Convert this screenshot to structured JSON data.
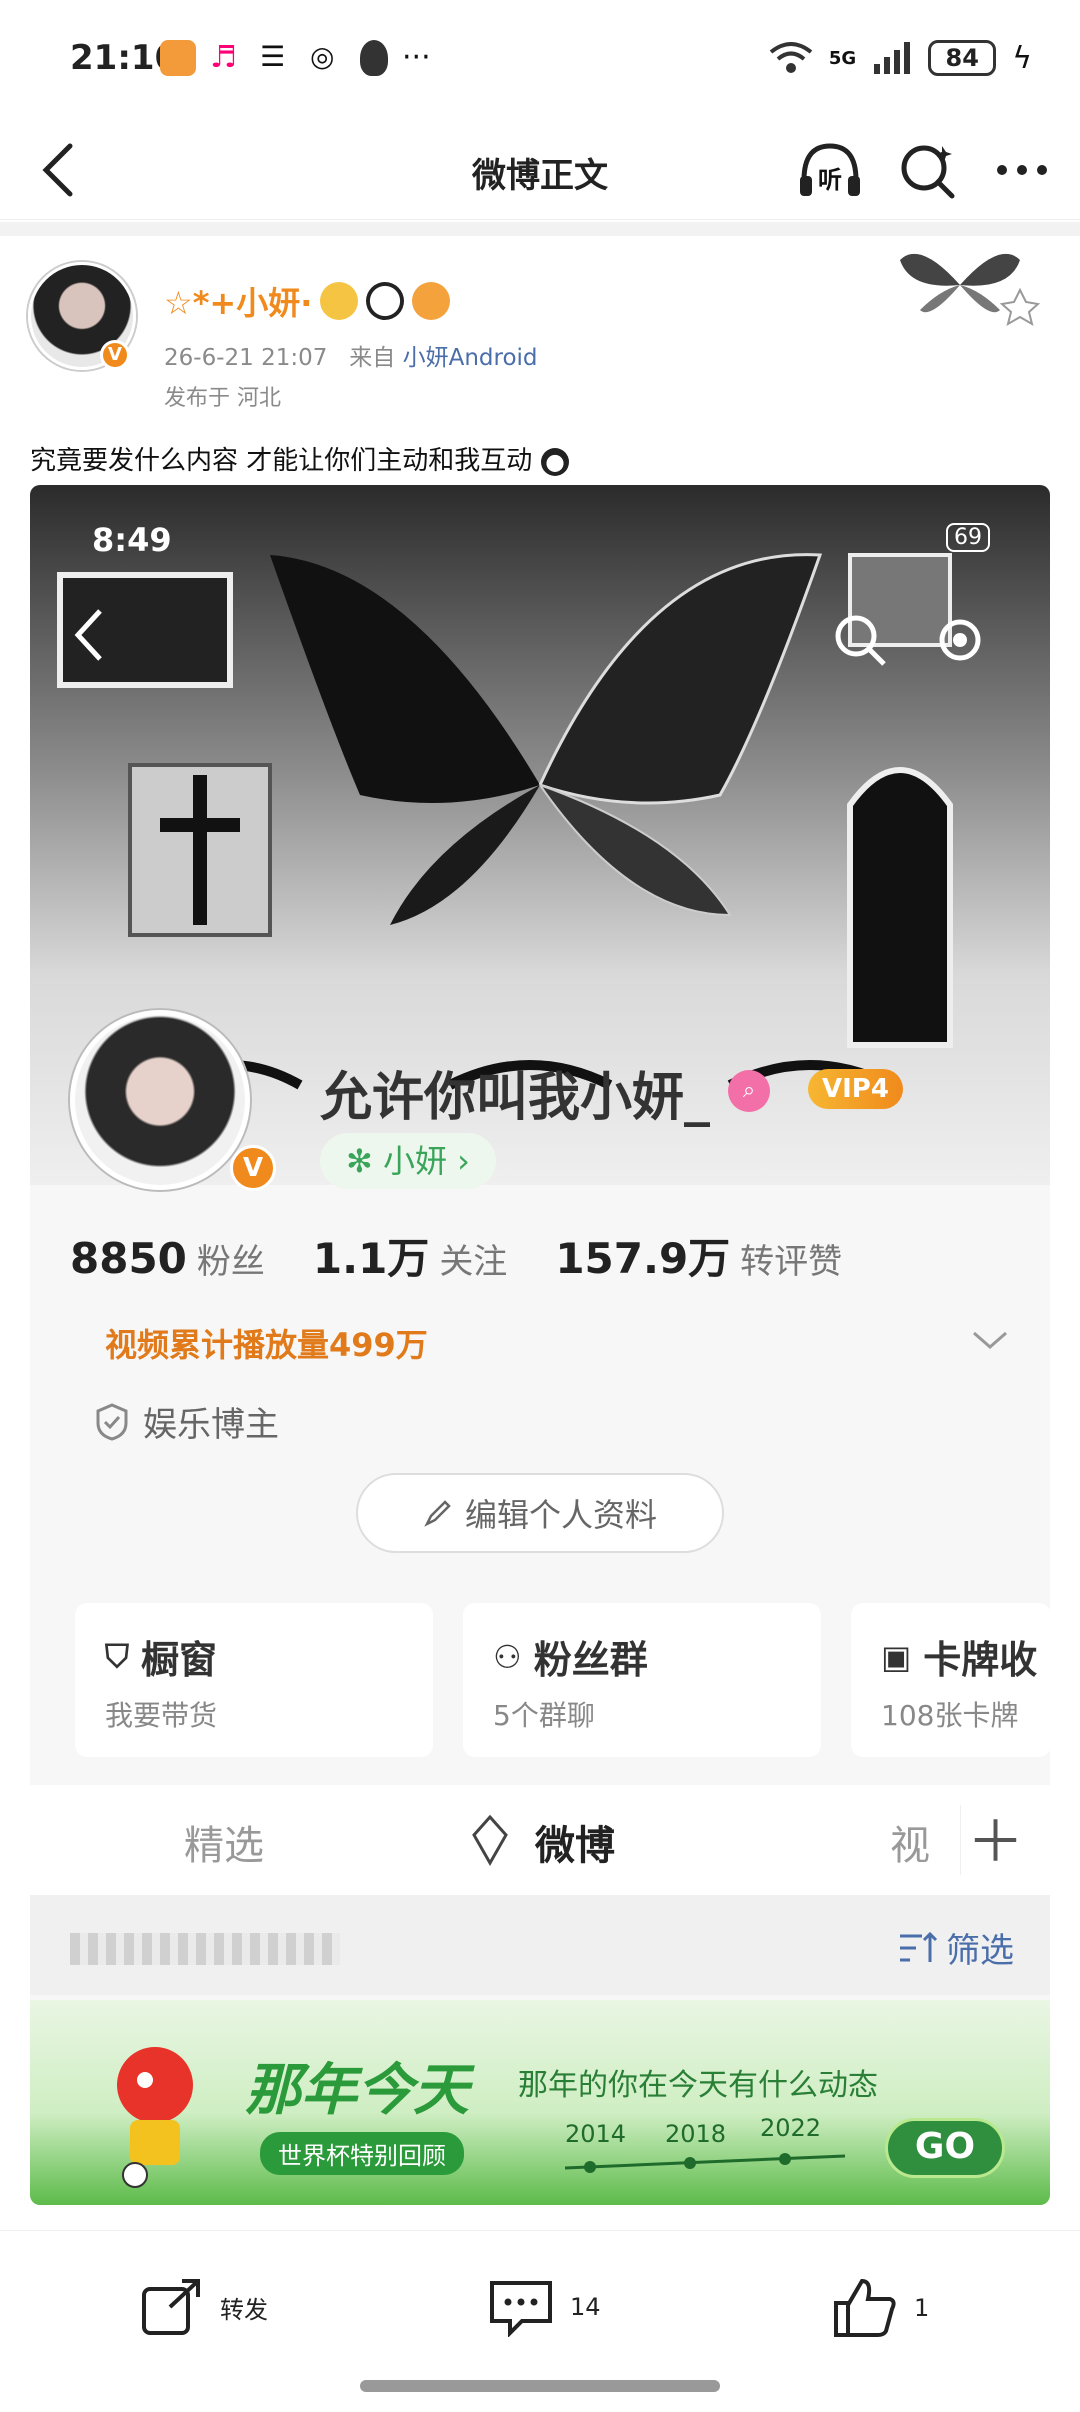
{
  "status_bar": {
    "time": "21:10",
    "battery": "84",
    "network": "5G"
  },
  "nav": {
    "title": "微博正文",
    "listen_label": "听"
  },
  "post": {
    "author": "☆*+小妍·",
    "date": "26-6-21 21:07",
    "source_prefix": "来自",
    "source": "小妍Android",
    "location": "发布于 河北",
    "text": "究竟要发什么内容 才能让你们主动和我互动"
  },
  "screenshot": {
    "time": "8:49",
    "battery": "69",
    "profile_name": "允许你叫我小妍_",
    "vip": "VIP4",
    "tag": "✻ 小妍 ›",
    "stats": [
      {
        "num": "8850",
        "label": "粉丝"
      },
      {
        "num": "1.1万",
        "label": "关注"
      },
      {
        "num": "157.9万",
        "label": "转评赞"
      }
    ],
    "video_views": "视频累计播放量499万",
    "verify": "娱乐博主",
    "edit_button": "编辑个人资料",
    "features": [
      {
        "title": "橱窗",
        "sub": "我要带货"
      },
      {
        "title": "粉丝群",
        "sub": "5个群聊"
      },
      {
        "title": "卡牌收",
        "sub": "108张卡牌"
      }
    ],
    "tabs": [
      "精选",
      "微博",
      "视"
    ],
    "filter": "筛选",
    "promo": {
      "title": "那年今天",
      "sub": "那年的你在今天有什么动态",
      "tag": "世界杯特别回顾",
      "years": [
        "2014",
        "2018",
        "2022"
      ],
      "go": "GO"
    }
  },
  "actions": {
    "repost": "转发",
    "comments": "14",
    "likes": "1"
  }
}
